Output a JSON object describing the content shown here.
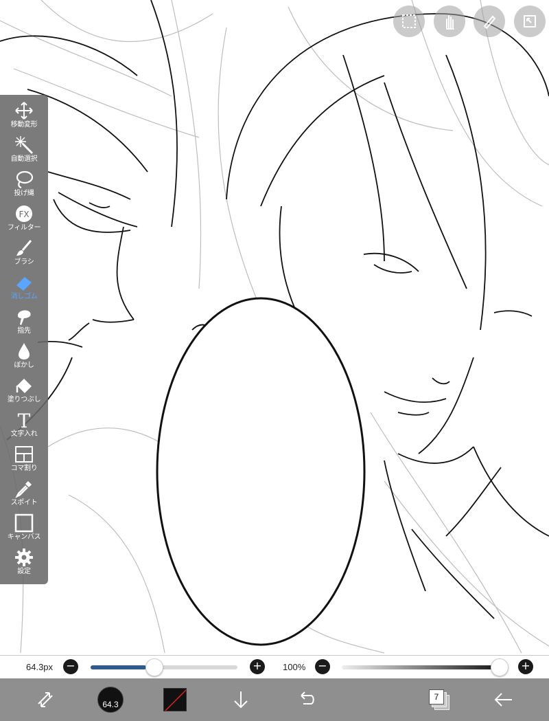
{
  "tools": [
    {
      "id": "move",
      "label": "移動変形",
      "icon": "move-arrows-icon"
    },
    {
      "id": "magic-wand",
      "label": "自動選択",
      "icon": "magic-wand-icon"
    },
    {
      "id": "lasso",
      "label": "投げ縄",
      "icon": "lasso-icon"
    },
    {
      "id": "filter",
      "label": "フィルター",
      "icon": "fx-icon",
      "glyph": "FX"
    },
    {
      "id": "brush",
      "label": "ブラシ",
      "icon": "brush-icon"
    },
    {
      "id": "eraser",
      "label": "消しゴム",
      "icon": "eraser-icon",
      "active": true
    },
    {
      "id": "smudge",
      "label": "指先",
      "icon": "smudge-icon"
    },
    {
      "id": "blur",
      "label": "ぼかし",
      "icon": "blur-drop-icon"
    },
    {
      "id": "fill",
      "label": "塗りつぶし",
      "icon": "bucket-icon"
    },
    {
      "id": "text",
      "label": "文字入れ",
      "icon": "text-icon",
      "glyph": "T"
    },
    {
      "id": "frame",
      "label": "コマ割り",
      "icon": "frame-divider-icon"
    },
    {
      "id": "eyedropper",
      "label": "スポイト",
      "icon": "eyedropper-icon"
    },
    {
      "id": "canvas",
      "label": "キャンバス",
      "icon": "canvas-icon"
    },
    {
      "id": "settings",
      "label": "設定",
      "icon": "gear-icon"
    }
  ],
  "sliders": {
    "size": {
      "value_label": "64.3px",
      "minus": "−",
      "plus": "+",
      "fill_fraction": 0.38
    },
    "opacity": {
      "value_label": "100%",
      "minus": "−",
      "plus": "+",
      "fill_fraction": 1.0
    }
  },
  "bottom_bar": {
    "brush_size_label": "64.3",
    "layer_count": "7"
  },
  "colors": {
    "panel_bg": "#696969",
    "active_tool": "#5aa6ff",
    "bottom_bar_bg": "#8f8f8f",
    "size_track": "#2f5a8a"
  }
}
